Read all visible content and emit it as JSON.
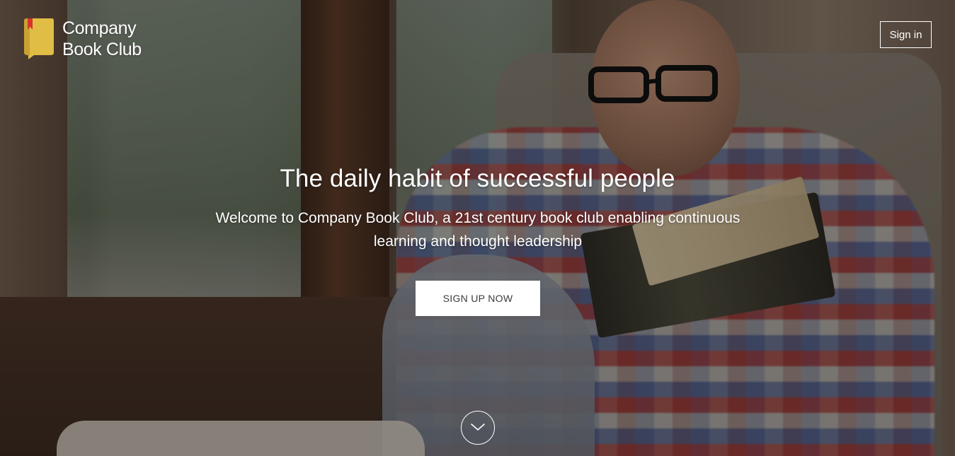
{
  "brand": {
    "line1": "Company",
    "line2": "Book Club"
  },
  "header": {
    "signin_label": "Sign in"
  },
  "hero": {
    "headline": "The daily habit of successful people",
    "subline": "Welcome to Company Book Club, a 21st century book club enabling continuous learning and thought leadership",
    "cta_label": "SIGN UP NOW"
  },
  "icons": {
    "logo": "book-bookmark-icon",
    "scroll": "chevron-down-icon"
  },
  "colors": {
    "logo_yellow": "#e0bd45",
    "bookmark_red": "#d8322c",
    "text": "#ffffff",
    "cta_bg": "#ffffff",
    "cta_text": "#3b3b3b"
  }
}
